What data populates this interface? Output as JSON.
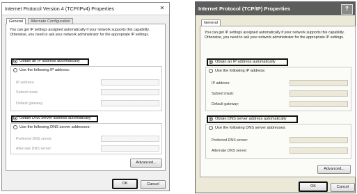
{
  "left_window": {
    "title": "Internet Protocol Version 4 (TCP/IPv4) Properties",
    "close_glyph": "✕",
    "tabs": [
      "General",
      "Alternate Configuration"
    ],
    "description": "You can get IP settings assigned automatically if your network supports this capability. Otherwise, you need to ask your network administrator for the appropriate IP settings.",
    "obtain_ip_auto": "Obtain an IP address automatically",
    "use_following_ip": "Use the following IP address:",
    "ip_address_label": "IP address:",
    "subnet_mask_label": "Subnet mask:",
    "default_gateway_label": "Default gateway:",
    "obtain_dns_auto": "Obtain DNS server address automatically",
    "use_following_dns": "Use the following DNS server addresses:",
    "preferred_dns_label": "Preferred DNS server:",
    "alternate_dns_label": "Alternate DNS server:",
    "advanced_button": "Advanced...",
    "ok_button": "OK",
    "cancel_button": "Cancel"
  },
  "right_window": {
    "title": "Internet Protocol (TCP/IP) Properties",
    "help_glyph": "?",
    "tabs": [
      "General"
    ],
    "description": "You can get IP settings assigned automatically if your network supports this capability. Otherwise, you need to ask your network administrator for the appropriate IP settings.",
    "obtain_ip_auto": "Obtain an IP address automatically",
    "use_following_ip": "Use the following IP address:",
    "ip_address_label": "IP address:",
    "subnet_mask_label": "Subnet mask:",
    "default_gateway_label": "Default gateway:",
    "obtain_dns_auto": "Obtain DNS server address automatically",
    "use_following_dns": "Use the following DNS server addresses:",
    "preferred_dns_label": "Preferred DNS server:",
    "alternate_dns_label": "Alternate DNS server:",
    "advanced_button": "Advanced...",
    "ok_button": "OK",
    "cancel_button": "Cancel"
  },
  "ip_placeholder_dot": "."
}
